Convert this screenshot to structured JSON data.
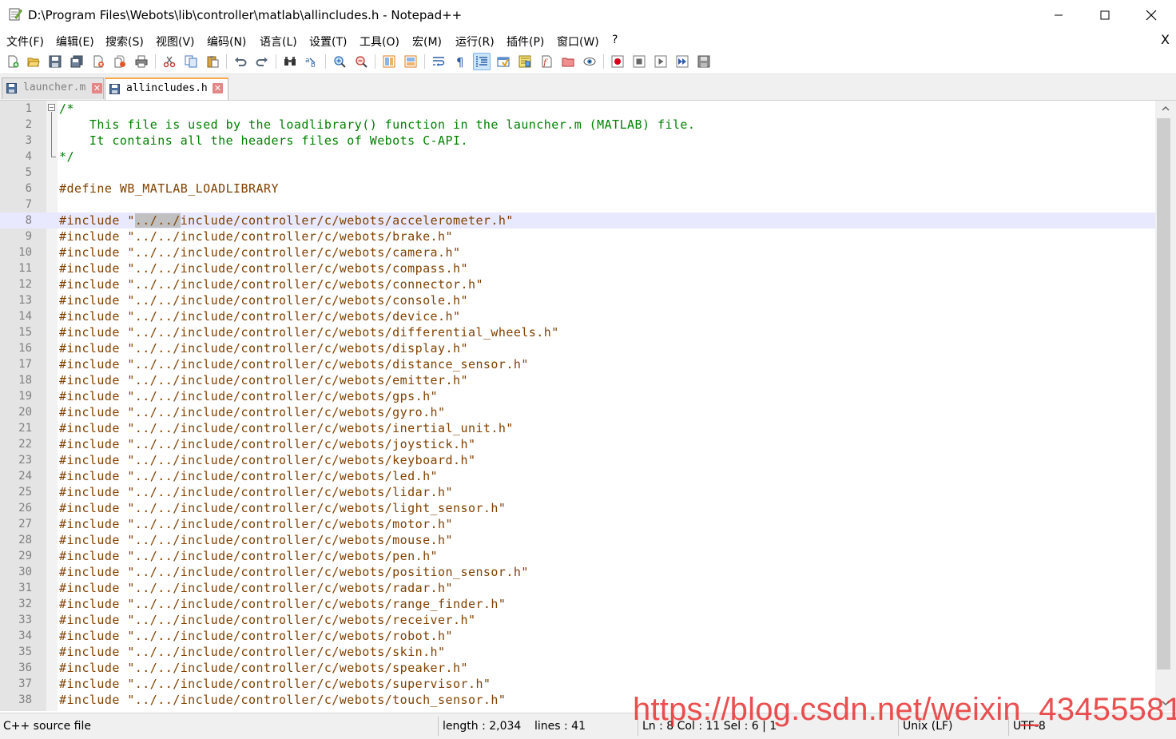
{
  "window": {
    "title": "D:\\Program Files\\Webots\\lib\\controller\\matlab\\allincludes.h - Notepad++"
  },
  "menu": {
    "items": [
      "文件(F)",
      "编辑(E)",
      "搜索(S)",
      "视图(V)",
      "编码(N)",
      "语言(L)",
      "设置(T)",
      "工具(O)",
      "宏(M)",
      "运行(R)",
      "插件(P)",
      "窗口(W)",
      "?"
    ],
    "close": "X"
  },
  "toolbar": {
    "icons": [
      "new-file-icon",
      "open-file-icon",
      "save-icon",
      "save-all-icon",
      "close-icon",
      "close-all-icon",
      "print-icon",
      "cut-icon",
      "copy-icon",
      "paste-icon",
      "undo-icon",
      "redo-icon",
      "find-icon",
      "replace-icon",
      "zoom-in-icon",
      "zoom-out-icon",
      "sync-vertical-icon",
      "sync-horizontal-icon",
      "word-wrap-icon",
      "show-all-chars-icon",
      "indent-guide-icon",
      "user-defined-language-icon",
      "document-map-icon",
      "function-list-icon",
      "folder-workspace-icon",
      "monitoring-icon",
      "record-macro-icon",
      "stop-macro-icon",
      "play-macro-icon",
      "run-macro-multiple-icon",
      "save-macro-icon"
    ]
  },
  "tabs": [
    {
      "label": "launcher.m",
      "active": false
    },
    {
      "label": "allincludes.h",
      "active": true
    }
  ],
  "editor": {
    "current_line": 8,
    "lines": [
      {
        "num": "1",
        "parts": [
          {
            "t": "/*",
            "c": "comment"
          }
        ]
      },
      {
        "num": "2",
        "parts": [
          {
            "t": "    This file is used by the loadlibrary() function in the launcher.m (MATLAB) file.",
            "c": "comment"
          }
        ]
      },
      {
        "num": "3",
        "parts": [
          {
            "t": "    It contains all the headers files of Webots C-API.",
            "c": "comment"
          }
        ]
      },
      {
        "num": "4",
        "parts": [
          {
            "t": "*/",
            "c": "comment"
          }
        ]
      },
      {
        "num": "5",
        "parts": []
      },
      {
        "num": "6",
        "parts": [
          {
            "t": "#define WB_MATLAB_LOADLIBRARY",
            "c": "pre"
          }
        ]
      },
      {
        "num": "7",
        "parts": []
      },
      {
        "num": "8",
        "parts": [
          {
            "t": "#include \"",
            "c": "pre"
          },
          {
            "t": "../../",
            "c": "pre sel"
          },
          {
            "t": "include/controller/c/webots/accelerometer.h\"",
            "c": "pre"
          }
        ]
      },
      {
        "num": "9",
        "parts": [
          {
            "t": "#include \"../../include/controller/c/webots/brake.h\"",
            "c": "pre"
          }
        ]
      },
      {
        "num": "10",
        "parts": [
          {
            "t": "#include \"../../include/controller/c/webots/camera.h\"",
            "c": "pre"
          }
        ]
      },
      {
        "num": "11",
        "parts": [
          {
            "t": "#include \"../../include/controller/c/webots/compass.h\"",
            "c": "pre"
          }
        ]
      },
      {
        "num": "12",
        "parts": [
          {
            "t": "#include \"../../include/controller/c/webots/connector.h\"",
            "c": "pre"
          }
        ]
      },
      {
        "num": "13",
        "parts": [
          {
            "t": "#include \"../../include/controller/c/webots/console.h\"",
            "c": "pre"
          }
        ]
      },
      {
        "num": "14",
        "parts": [
          {
            "t": "#include \"../../include/controller/c/webots/device.h\"",
            "c": "pre"
          }
        ]
      },
      {
        "num": "15",
        "parts": [
          {
            "t": "#include \"../../include/controller/c/webots/differential_wheels.h\"",
            "c": "pre"
          }
        ]
      },
      {
        "num": "16",
        "parts": [
          {
            "t": "#include \"../../include/controller/c/webots/display.h\"",
            "c": "pre"
          }
        ]
      },
      {
        "num": "17",
        "parts": [
          {
            "t": "#include \"../../include/controller/c/webots/distance_sensor.h\"",
            "c": "pre"
          }
        ]
      },
      {
        "num": "18",
        "parts": [
          {
            "t": "#include \"../../include/controller/c/webots/emitter.h\"",
            "c": "pre"
          }
        ]
      },
      {
        "num": "19",
        "parts": [
          {
            "t": "#include \"../../include/controller/c/webots/gps.h\"",
            "c": "pre"
          }
        ]
      },
      {
        "num": "20",
        "parts": [
          {
            "t": "#include \"../../include/controller/c/webots/gyro.h\"",
            "c": "pre"
          }
        ]
      },
      {
        "num": "21",
        "parts": [
          {
            "t": "#include \"../../include/controller/c/webots/inertial_unit.h\"",
            "c": "pre"
          }
        ]
      },
      {
        "num": "22",
        "parts": [
          {
            "t": "#include \"../../include/controller/c/webots/joystick.h\"",
            "c": "pre"
          }
        ]
      },
      {
        "num": "23",
        "parts": [
          {
            "t": "#include \"../../include/controller/c/webots/keyboard.h\"",
            "c": "pre"
          }
        ]
      },
      {
        "num": "24",
        "parts": [
          {
            "t": "#include \"../../include/controller/c/webots/led.h\"",
            "c": "pre"
          }
        ]
      },
      {
        "num": "25",
        "parts": [
          {
            "t": "#include \"../../include/controller/c/webots/lidar.h\"",
            "c": "pre"
          }
        ]
      },
      {
        "num": "26",
        "parts": [
          {
            "t": "#include \"../../include/controller/c/webots/light_sensor.h\"",
            "c": "pre"
          }
        ]
      },
      {
        "num": "27",
        "parts": [
          {
            "t": "#include \"../../include/controller/c/webots/motor.h\"",
            "c": "pre"
          }
        ]
      },
      {
        "num": "28",
        "parts": [
          {
            "t": "#include \"../../include/controller/c/webots/mouse.h\"",
            "c": "pre"
          }
        ]
      },
      {
        "num": "29",
        "parts": [
          {
            "t": "#include \"../../include/controller/c/webots/pen.h\"",
            "c": "pre"
          }
        ]
      },
      {
        "num": "30",
        "parts": [
          {
            "t": "#include \"../../include/controller/c/webots/position_sensor.h\"",
            "c": "pre"
          }
        ]
      },
      {
        "num": "31",
        "parts": [
          {
            "t": "#include \"../../include/controller/c/webots/radar.h\"",
            "c": "pre"
          }
        ]
      },
      {
        "num": "32",
        "parts": [
          {
            "t": "#include \"../../include/controller/c/webots/range_finder.h\"",
            "c": "pre"
          }
        ]
      },
      {
        "num": "33",
        "parts": [
          {
            "t": "#include \"../../include/controller/c/webots/receiver.h\"",
            "c": "pre"
          }
        ]
      },
      {
        "num": "34",
        "parts": [
          {
            "t": "#include \"../../include/controller/c/webots/robot.h\"",
            "c": "pre"
          }
        ]
      },
      {
        "num": "35",
        "parts": [
          {
            "t": "#include \"../../include/controller/c/webots/skin.h\"",
            "c": "pre"
          }
        ]
      },
      {
        "num": "36",
        "parts": [
          {
            "t": "#include \"../../include/controller/c/webots/speaker.h\"",
            "c": "pre"
          }
        ]
      },
      {
        "num": "37",
        "parts": [
          {
            "t": "#include \"../../include/controller/c/webots/supervisor.h\"",
            "c": "pre"
          }
        ]
      },
      {
        "num": "38",
        "parts": [
          {
            "t": "#include \"../../include/controller/c/webots/touch_sensor.h\"",
            "c": "pre"
          }
        ]
      }
    ]
  },
  "status": {
    "filetype": "C++ source file",
    "length": "length : 2,034",
    "lines": "lines : 41",
    "position": "Ln : 8    Col : 11    Sel : 6 | 1",
    "eol": "Unix (LF)",
    "encoding": "UTF-8"
  },
  "watermark": "https://blog.csdn.net/weixin_43455581",
  "colors": {
    "comment": "#008000",
    "preprocessor": "#804000",
    "line_number": "#808080",
    "current_line_bg": "#e8e8ff",
    "selection_bg": "#c0c0c0",
    "watermark": "#e62828"
  }
}
